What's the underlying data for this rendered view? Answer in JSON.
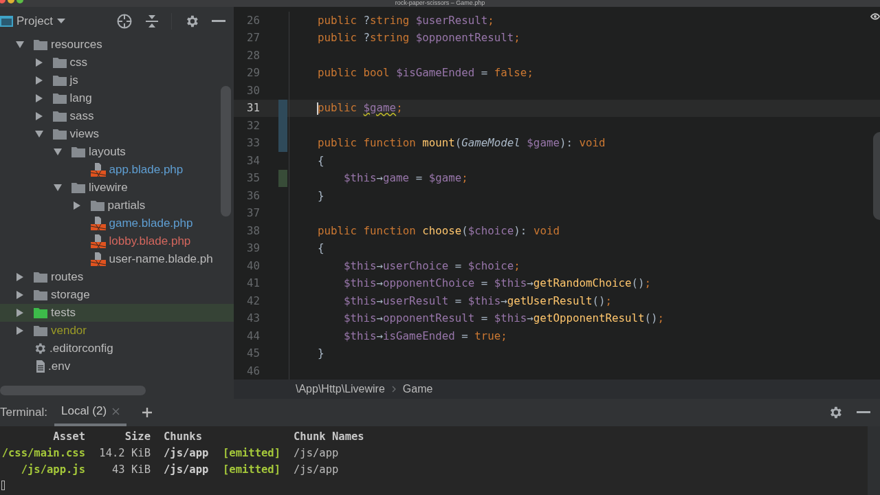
{
  "window": {
    "title": "rock-paper-scissors – Game.php"
  },
  "project_panel": {
    "title": "Project",
    "tree": [
      {
        "name": "resources",
        "kind": "folder",
        "expanded": true,
        "selected": false,
        "children": [
          {
            "name": "css",
            "kind": "folder",
            "expanded": false,
            "selected": false
          },
          {
            "name": "js",
            "kind": "folder",
            "expanded": false,
            "selected": false
          },
          {
            "name": "lang",
            "kind": "folder",
            "expanded": false,
            "selected": false
          },
          {
            "name": "sass",
            "kind": "folder",
            "expanded": false,
            "selected": false
          },
          {
            "name": "views",
            "kind": "folder",
            "expanded": true,
            "selected": false,
            "children": [
              {
                "name": "layouts",
                "kind": "folder",
                "expanded": true,
                "selected": false,
                "children": [
                  {
                    "name": "app.blade.php",
                    "kind": "blade",
                    "modified": true,
                    "selected": false
                  }
                ]
              },
              {
                "name": "livewire",
                "kind": "folder",
                "expanded": true,
                "selected": false,
                "children": [
                  {
                    "name": "partials",
                    "kind": "folder",
                    "expanded": false,
                    "selected": false
                  },
                  {
                    "name": "game.blade.php",
                    "kind": "blade",
                    "modified": true,
                    "selected": false
                  },
                  {
                    "name": "lobby.blade.php",
                    "kind": "blade",
                    "unversioned": true,
                    "selected": false
                  },
                  {
                    "name": "user-name.blade.ph",
                    "kind": "blade",
                    "modified": false,
                    "selected": false
                  }
                ]
              }
            ]
          }
        ]
      },
      {
        "name": "routes",
        "kind": "folder",
        "expanded": false,
        "excluded": false,
        "selected": false
      },
      {
        "name": "storage",
        "kind": "folder",
        "expanded": false,
        "excluded": false,
        "selected": false
      },
      {
        "name": "tests",
        "kind": "test_folder",
        "expanded": false,
        "excluded": false,
        "selected": true
      },
      {
        "name": "vendor",
        "kind": "folder",
        "expanded": false,
        "excluded": true,
        "selected": false
      },
      {
        "name": ".editorconfig",
        "kind": "config",
        "selected": false
      },
      {
        "name": ".env",
        "kind": "text",
        "selected": false
      }
    ]
  },
  "editor": {
    "lines": [
      {
        "number": "26",
        "current": false,
        "tokens": [
          {
            "text": "public ",
            "kind": "kw"
          },
          {
            "text": "?",
            "kind": "plain"
          },
          {
            "text": "string ",
            "kind": "kw"
          },
          {
            "text": "$userResult",
            "kind": "var"
          },
          {
            "text": ";",
            "kind": "semi"
          }
        ]
      },
      {
        "number": "27",
        "current": false,
        "tokens": [
          {
            "text": "public ",
            "kind": "kw"
          },
          {
            "text": "?",
            "kind": "plain"
          },
          {
            "text": "string ",
            "kind": "kw"
          },
          {
            "text": "$opponentResult",
            "kind": "var"
          },
          {
            "text": ";",
            "kind": "semi"
          }
        ]
      },
      {
        "number": "28",
        "current": false
      },
      {
        "number": "29",
        "current": false,
        "tokens": [
          {
            "text": "public bool ",
            "kind": "kw"
          },
          {
            "text": "$isGameEnded",
            "kind": "var"
          },
          {
            "text": " = ",
            "kind": "plain"
          },
          {
            "text": "false",
            "kind": "kw"
          },
          {
            "text": ";",
            "kind": "semi"
          }
        ]
      },
      {
        "number": "30",
        "current": false
      },
      {
        "number": "31",
        "current": true,
        "modified": true,
        "tokens": [
          {
            "text": "public ",
            "kind": "kw"
          },
          {
            "text": "$game",
            "kind": "warn_var"
          },
          {
            "text": ";",
            "kind": "semi"
          }
        ]
      },
      {
        "number": "32",
        "current": false,
        "modified": true
      },
      {
        "number": "33",
        "current": false,
        "modified": true,
        "tokens": [
          {
            "text": "public function ",
            "kind": "kw"
          },
          {
            "text": "mount",
            "kind": "fn"
          },
          {
            "text": "(",
            "kind": "plain"
          },
          {
            "text": "GameModel ",
            "kind": "type"
          },
          {
            "text": "$game",
            "kind": "var"
          },
          {
            "text": "): ",
            "kind": "plain"
          },
          {
            "text": "void",
            "kind": "kw"
          }
        ]
      },
      {
        "number": "34",
        "current": false,
        "tokens": [
          {
            "text": "{",
            "kind": "plain"
          }
        ],
        "children": [
          {
            "number": "35",
            "current": false,
            "added": true,
            "tokens": [
              {
                "text": "$this",
                "kind": "var"
              },
              {
                "text": "→",
                "kind": "plain"
              },
              {
                "text": "game",
                "kind": "var"
              },
              {
                "text": " = ",
                "kind": "plain"
              },
              {
                "text": "$game",
                "kind": "var"
              },
              {
                "text": ";",
                "kind": "semi"
              }
            ]
          }
        ]
      },
      {
        "number": "36",
        "current": false,
        "tokens": [
          {
            "text": "}",
            "kind": "plain"
          }
        ]
      },
      {
        "number": "37",
        "current": false
      },
      {
        "number": "38",
        "current": false,
        "tokens": [
          {
            "text": "public function ",
            "kind": "kw"
          },
          {
            "text": "choose",
            "kind": "fn"
          },
          {
            "text": "(",
            "kind": "plain"
          },
          {
            "text": "$choice",
            "kind": "var"
          },
          {
            "text": "): ",
            "kind": "plain"
          },
          {
            "text": "void",
            "kind": "kw"
          }
        ]
      },
      {
        "number": "39",
        "current": false,
        "tokens": [
          {
            "text": "{",
            "kind": "plain"
          }
        ],
        "children": [
          {
            "number": "40",
            "current": false,
            "tokens": [
              {
                "text": "$this",
                "kind": "var"
              },
              {
                "text": "→",
                "kind": "plain"
              },
              {
                "text": "userChoice",
                "kind": "var"
              },
              {
                "text": " = ",
                "kind": "plain"
              },
              {
                "text": "$choice",
                "kind": "var"
              },
              {
                "text": ";",
                "kind": "semi"
              }
            ]
          },
          {
            "number": "41",
            "current": false,
            "tokens": [
              {
                "text": "$this",
                "kind": "var"
              },
              {
                "text": "→",
                "kind": "plain"
              },
              {
                "text": "opponentChoice",
                "kind": "var"
              },
              {
                "text": " = ",
                "kind": "plain"
              },
              {
                "text": "$this",
                "kind": "var"
              },
              {
                "text": "→",
                "kind": "plain"
              },
              {
                "text": "getRandomChoice",
                "kind": "fn"
              },
              {
                "text": "()",
                "kind": "plain"
              },
              {
                "text": ";",
                "kind": "semi"
              }
            ]
          },
          {
            "number": "42",
            "current": false,
            "tokens": [
              {
                "text": "$this",
                "kind": "var"
              },
              {
                "text": "→",
                "kind": "plain"
              },
              {
                "text": "userResult",
                "kind": "var"
              },
              {
                "text": " = ",
                "kind": "plain"
              },
              {
                "text": "$this",
                "kind": "var"
              },
              {
                "text": "→",
                "kind": "plain"
              },
              {
                "text": "getUserResult",
                "kind": "fn"
              },
              {
                "text": "()",
                "kind": "plain"
              },
              {
                "text": ";",
                "kind": "semi"
              }
            ]
          },
          {
            "number": "43",
            "current": false,
            "tokens": [
              {
                "text": "$this",
                "kind": "var"
              },
              {
                "text": "→",
                "kind": "plain"
              },
              {
                "text": "opponentResult",
                "kind": "var"
              },
              {
                "text": " = ",
                "kind": "plain"
              },
              {
                "text": "$this",
                "kind": "var"
              },
              {
                "text": "→",
                "kind": "plain"
              },
              {
                "text": "getOpponentResult",
                "kind": "fn"
              },
              {
                "text": "()",
                "kind": "plain"
              },
              {
                "text": ";",
                "kind": "semi"
              }
            ]
          },
          {
            "number": "44",
            "current": false,
            "tokens": [
              {
                "text": "$this",
                "kind": "var"
              },
              {
                "text": "→",
                "kind": "plain"
              },
              {
                "text": "isGameEnded",
                "kind": "var"
              },
              {
                "text": " = ",
                "kind": "plain"
              },
              {
                "text": "true",
                "kind": "kw"
              },
              {
                "text": ";",
                "kind": "semi"
              }
            ]
          }
        ]
      },
      {
        "number": "45",
        "current": false,
        "tokens": [
          {
            "text": "}",
            "kind": "plain"
          }
        ]
      },
      {
        "number": "46",
        "current": false
      }
    ],
    "breadcrumbs": [
      "\\App\\Http\\Livewire",
      "Game"
    ]
  },
  "terminal": {
    "label": "Terminal:",
    "tabs": [
      {
        "label": "Local (2)",
        "selected": true
      }
    ],
    "columns": [
      "Asset",
      "Size",
      "Chunks",
      "",
      "Chunk Names"
    ],
    "rows": [
      [
        "/css/main.css",
        "14.2 KiB",
        "/js/app",
        "[emitted]",
        "/js/app"
      ],
      [
        "/js/app.js",
        "43 KiB",
        "/js/app",
        "[emitted]",
        "/js/app"
      ]
    ]
  }
}
